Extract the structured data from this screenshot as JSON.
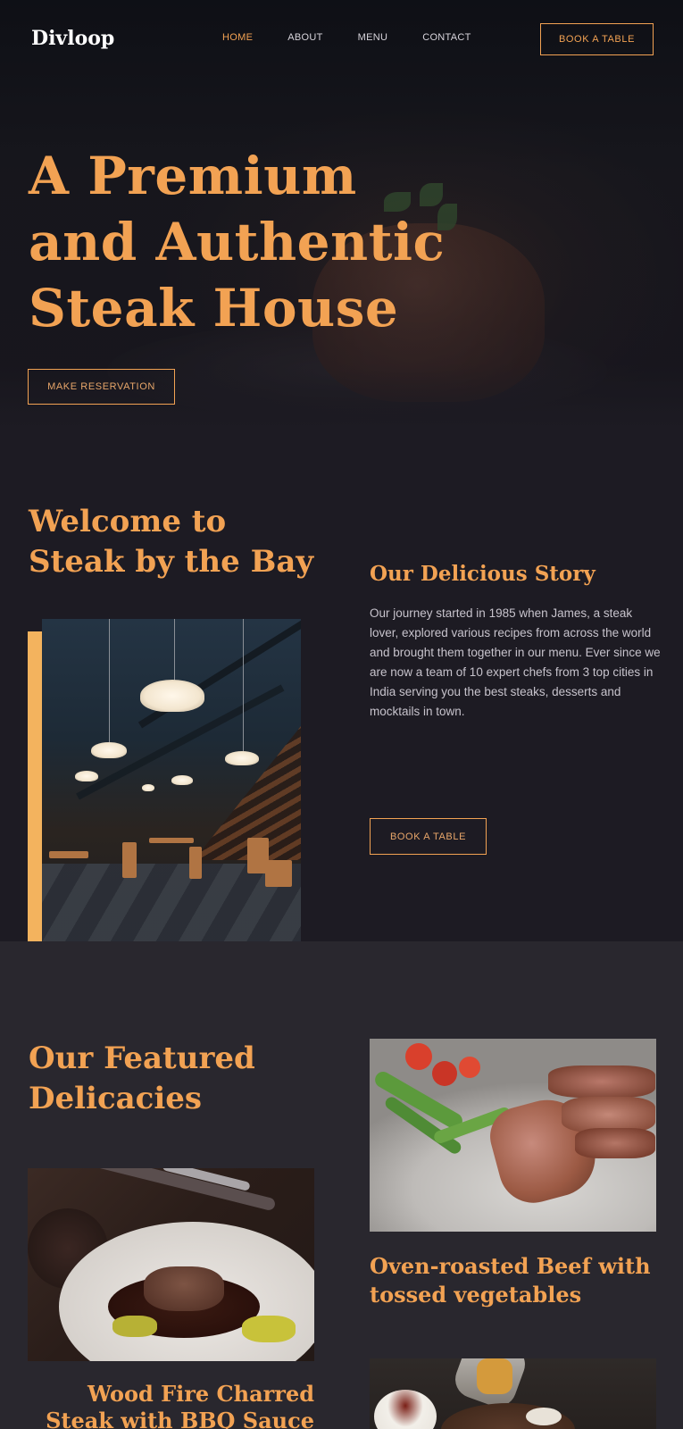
{
  "nav": {
    "logo": "Divloop",
    "items": [
      {
        "label": "HOME",
        "active": true
      },
      {
        "label": "ABOUT",
        "active": false
      },
      {
        "label": "MENU",
        "active": false
      },
      {
        "label": "CONTACT",
        "active": false
      }
    ],
    "cta": "BOOK A TABLE"
  },
  "hero": {
    "title_lines": [
      "A Premium",
      "and Authentic",
      "Steak House"
    ],
    "cta": "MAKE RESERVATION"
  },
  "welcome": {
    "title_lines": [
      "Welcome to",
      "Steak by the Bay"
    ],
    "story_title": "Our Delicious Story",
    "story_text": "Our journey started in 1985 when James, a steak lover, explored various recipes from across the world and brought them together in our menu. Ever since we are now a team of 10 expert chefs from 3 top cities in India serving you the best steaks, desserts and mocktails in town.",
    "cta": "BOOK A TABLE"
  },
  "featured": {
    "title_lines": [
      "Our Featured",
      "Delicacies"
    ],
    "dishes": [
      {
        "title": "Oven-roasted Beef with tossed vegetables"
      },
      {
        "title": "Wood Fire Charred Steak with BBQ Sauce"
      }
    ]
  },
  "colors": {
    "accent": "#f2a253",
    "frame": "#f3b35e",
    "background": "#1d1b23",
    "section_alt": "#29272e"
  }
}
